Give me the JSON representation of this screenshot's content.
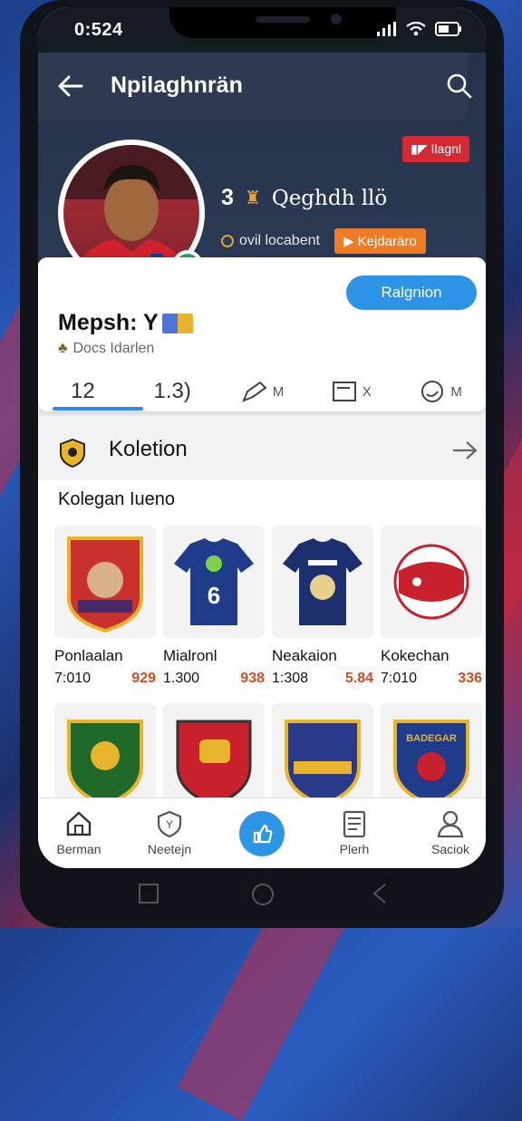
{
  "status": {
    "time": "0:524"
  },
  "appbar": {
    "title": "Npilaghnrän",
    "back_icon": "arrow-left-icon",
    "search_icon": "search-icon"
  },
  "profile": {
    "badge": "Ilagnl",
    "stat_number": "3",
    "stat_name": "Qeghdh llö",
    "location": "ovil locabent",
    "orange_button": "Kejdarāro",
    "register_button": "Ralgnion",
    "username": "Mepsh: Y",
    "subtitle": "Docs Idarlen"
  },
  "tabs": [
    {
      "label": "12",
      "suffix": ""
    },
    {
      "label": "1.3) ",
      "suffix": ""
    },
    {
      "label": "",
      "suffix": "M"
    },
    {
      "label": "",
      "suffix": "X"
    },
    {
      "label": "",
      "suffix": "M"
    }
  ],
  "section": {
    "title": "Koletion"
  },
  "collection": {
    "subtitle": "Kolegan Iueno",
    "items": [
      {
        "name": "Ponlaalan",
        "price": "7:010",
        "points": "929"
      },
      {
        "name": "Mialronl",
        "price": "1.300",
        "points": "938"
      },
      {
        "name": "Neakaion",
        "price": "1:308",
        "points": "5.84"
      },
      {
        "name": "Kokechan",
        "price": "7:010",
        "points": "336"
      }
    ],
    "row2_labels": [
      "",
      "",
      "",
      "BADEGAR"
    ]
  },
  "nav": {
    "items": [
      {
        "label": "Berman"
      },
      {
        "label": "Neetejn"
      },
      {
        "label": ""
      },
      {
        "label": "Plerh"
      },
      {
        "label": "Saciok"
      }
    ]
  },
  "colors": {
    "accent": "#2d93e6",
    "dark_header": "#25324a",
    "badge_red": "#d42a35",
    "orange": "#f07b22"
  }
}
